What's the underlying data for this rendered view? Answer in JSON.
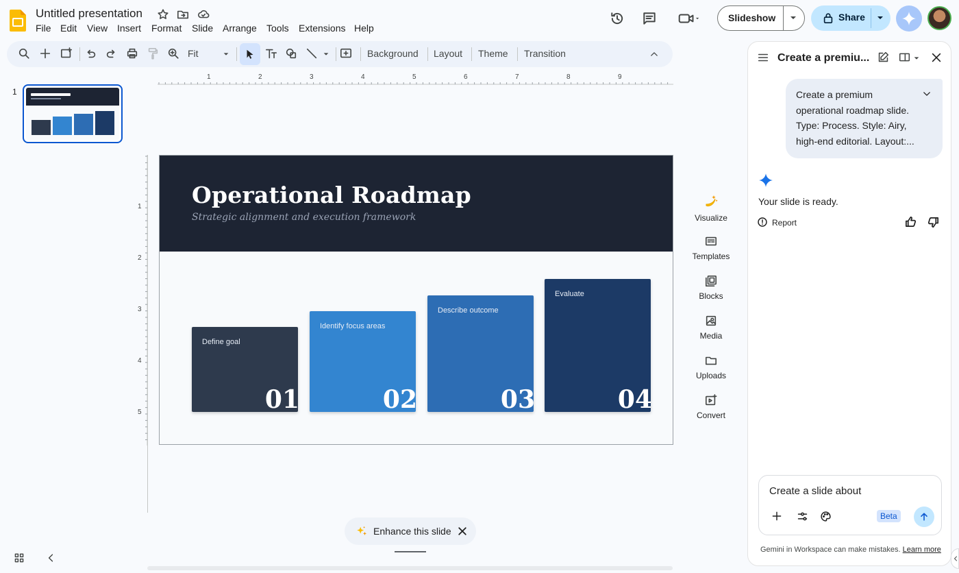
{
  "header": {
    "doc_title": "Untitled presentation",
    "menu": [
      "File",
      "Edit",
      "View",
      "Insert",
      "Format",
      "Slide",
      "Arrange",
      "Tools",
      "Extensions",
      "Help"
    ],
    "slideshow_label": "Slideshow",
    "share_label": "Share",
    "colors": {
      "share_bg": "#c2e7ff",
      "gemini_bg": "#a8c7fa"
    }
  },
  "toolbar": {
    "zoom_value": "Fit",
    "background_label": "Background",
    "layout_label": "Layout",
    "theme_label": "Theme",
    "transition_label": "Transition"
  },
  "filmstrip": {
    "slide_number": "1"
  },
  "ruler": {
    "horizontal": [
      "1",
      "2",
      "3",
      "4",
      "5",
      "6",
      "7",
      "8",
      "9"
    ],
    "vertical": [
      "1",
      "2",
      "3",
      "4",
      "5"
    ]
  },
  "slide": {
    "title": "Operational Roadmap",
    "subtitle": "Strategic alignment and execution framework",
    "steps": [
      {
        "label": "Define goal",
        "number": "01",
        "color": "#2e3a4d"
      },
      {
        "label": "Identify focus areas",
        "number": "02",
        "color": "#3385d0"
      },
      {
        "label": "Describe outcome",
        "number": "03",
        "color": "#2d6db4"
      },
      {
        "label": "Evaluate",
        "number": "04",
        "color": "#1c3a66"
      }
    ]
  },
  "side_tools": [
    "Visualize",
    "Templates",
    "Blocks",
    "Media",
    "Uploads",
    "Convert"
  ],
  "enhance": {
    "label": "Enhance this slide"
  },
  "panel": {
    "title": "Create a premiu...",
    "prompt": "Create a premium operational roadmap slide. Type: Process. Style: Airy, high-end editorial. Layout:...",
    "response": "Your slide is ready.",
    "report_label": "Report",
    "input_text": "Create a slide about",
    "beta_label": "Beta",
    "disclaimer": "Gemini in Workspace can make mistakes.",
    "learn_more": "Learn more"
  }
}
